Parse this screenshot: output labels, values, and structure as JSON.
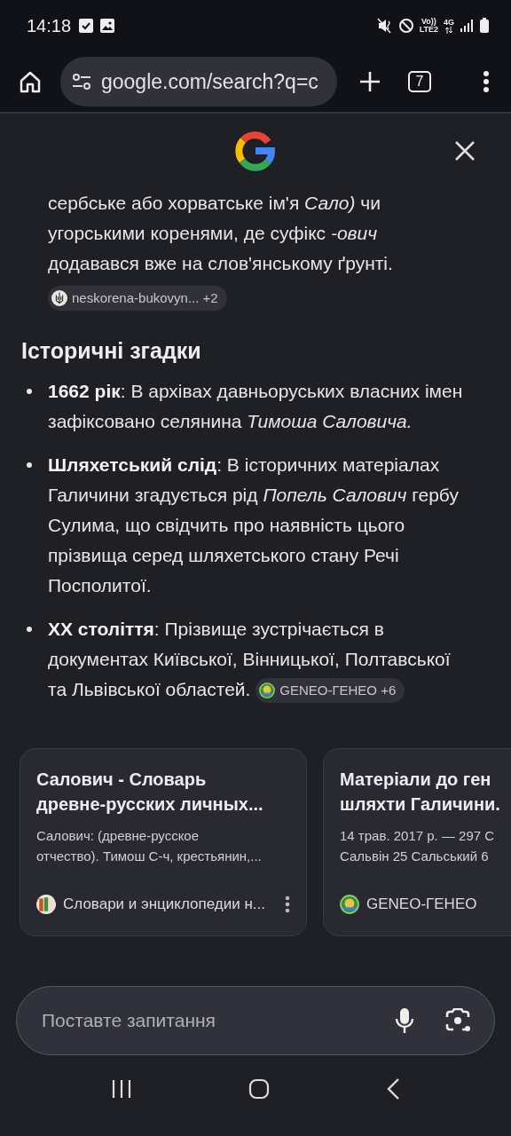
{
  "status_bar": {
    "time": "14:18",
    "volte": "Vo))",
    "lte": "LTE2",
    "network": "4G"
  },
  "toolbar": {
    "url": "google.com/search?q=c",
    "tab_count": "7"
  },
  "answer": {
    "intro": "сербське або хорватське ім'я *Сало)* чи угорськими коренями, де суфікс *-ович* додавався вже на слов'янському ґрунті.",
    "intro_source": {
      "site": "neskorena-bukovyn...",
      "more": "+2",
      "kind": "emblem"
    },
    "heading": "Історичні згадки",
    "bullets": [
      {
        "text": "**1662 рік**: В архівах давньоруських власних імен зафіксовано селянина *Тимоша Саловича.*"
      },
      {
        "text": "**Шляхетський слід**: В історичних матеріалах Галичини згадується рід *Попель Салович* гербу Сулима, що свідчить про наявність цього прізвища серед шляхетського стану Речі Посполитої."
      },
      {
        "text": "**XX століття**: Прізвище зустрічається в документах Київської, Вінницької, Полтавської та Львівської областей.",
        "source": {
          "site": "GENEO-ГЕНЕО",
          "more": "+6",
          "kind": "geneo"
        }
      }
    ]
  },
  "cards": [
    {
      "title_lines": [
        "Салович - Словарь",
        "древне-русских личных..."
      ],
      "snippet_lines": [
        "Салович: (древне-русское",
        "отчество). Тимош С-ч, крестьянин,..."
      ],
      "source": "Словари и энциклопедии н...",
      "kind": "books",
      "menu": true
    },
    {
      "title_lines": [
        "Матеріали до ген",
        "шляхти Галичини."
      ],
      "snippet_lines": [
        "14 трав. 2017 р. — 297 С",
        "Сальвін 25 Сальський 6"
      ],
      "source": "GENEO-ГЕНЕО",
      "kind": "geneo",
      "menu": false
    }
  ],
  "ask_bar": {
    "placeholder": "Поставте запитання"
  }
}
